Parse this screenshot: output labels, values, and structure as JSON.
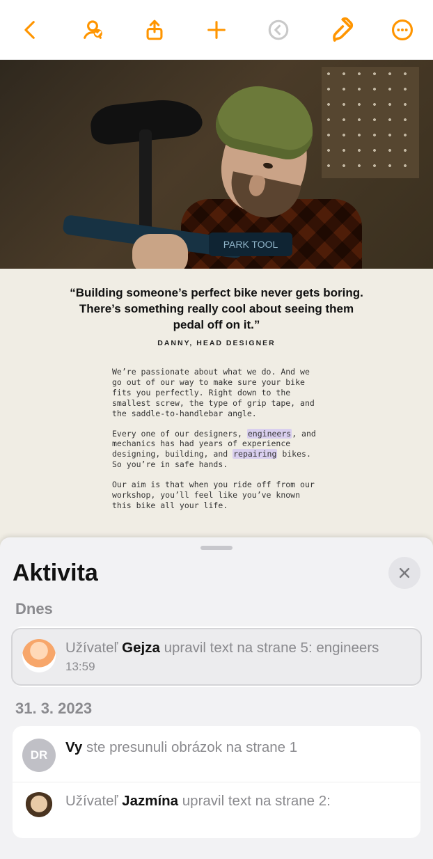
{
  "toolbar": {
    "back": "Back",
    "collaborate": "Collaborate",
    "share": "Share",
    "add": "Add",
    "undo": "Undo",
    "format": "Format",
    "more": "More"
  },
  "document": {
    "quote": "“Building someone’s perfect bike never gets boring. There’s something really cool about seeing them pedal off on it.”",
    "byline": "DANNY, HEAD DESIGNER",
    "para1": "We’re passionate about what we do. And we go out of our way to make sure your bike fits you perfectly. Right down to the smallest screw, the type of grip tape, and the saddle-to-handlebar angle.",
    "para2a": "Every one of our designers, ",
    "hl1": "engineers",
    "para2b": ", and mechanics has had years of experience designing, building, and ",
    "hl2": "repairing",
    "para2c": " bikes. So you’re in safe hands.",
    "para3": "Our aim is that when you ride off from our workshop, you’ll feel like you’ve known this bike all your life.",
    "stand_label": "PARK TOOL"
  },
  "sheet": {
    "title": "Aktivita",
    "close": "Close",
    "sections": [
      {
        "label": "Dnes",
        "items": [
          {
            "highlight": true,
            "avatar": "memoji1",
            "prefix": "Užívateľ ",
            "name": "Gejza",
            "rest": " upravil text na strane 5: engineers",
            "time": "13:59"
          }
        ]
      },
      {
        "label": "31. 3. 2023",
        "items": [
          {
            "highlight": false,
            "avatar": "initials",
            "initials": "DR",
            "prefix": "",
            "name": "Vy",
            "rest": " ste presunuli obrázok na strane 1",
            "time": ""
          },
          {
            "highlight": false,
            "avatar": "memoji2",
            "prefix": "Užívateľ ",
            "name": "Jazmína",
            "rest": " upravil text na strane 2:",
            "time": ""
          }
        ]
      }
    ]
  }
}
